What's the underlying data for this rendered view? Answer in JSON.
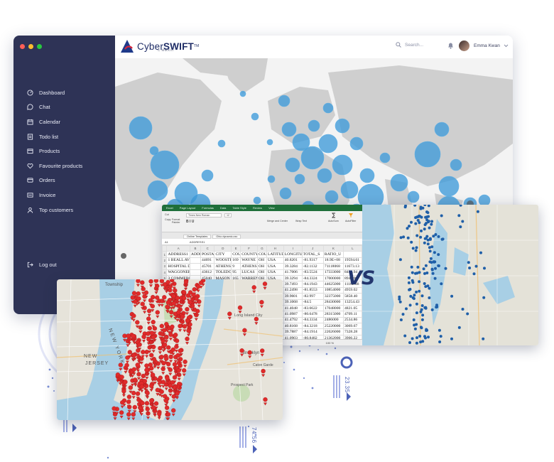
{
  "window": {
    "traffic_colors": [
      "#ff5f57",
      "#febc2e",
      "#28c840"
    ]
  },
  "brand": {
    "name_light": "Cyber",
    "name_bold": "SWIFT",
    "trademark": "TM",
    "sub": "C MMXIII",
    "logo_colors": [
      "#1f3a8a",
      "#d7263d"
    ]
  },
  "header": {
    "search_placeholder": "Search...",
    "user_name": "Emma Kwan"
  },
  "sidebar": {
    "items": [
      {
        "label": "Dashboard",
        "icon": "dashboard-icon"
      },
      {
        "label": "Chat",
        "icon": "chat-icon"
      },
      {
        "label": "Calendar",
        "icon": "calendar-icon"
      },
      {
        "label": "Todo list",
        "icon": "todo-icon"
      },
      {
        "label": "Products",
        "icon": "products-icon"
      },
      {
        "label": "Favourite products",
        "icon": "heart-icon"
      },
      {
        "label": "Orders",
        "icon": "orders-icon"
      },
      {
        "label": "Invoice",
        "icon": "invoice-icon"
      },
      {
        "label": "Top customers",
        "icon": "user-icon"
      }
    ],
    "logout": "Log out"
  },
  "excel": {
    "tabs": [
      "Excel",
      "Page Layout",
      "Formulas",
      "Data",
      "Table Style",
      "Review",
      "View"
    ],
    "font": "Times New Roman",
    "font_size": "12",
    "ribbon_labels": [
      "Cut",
      "Copy",
      "Format Painter",
      "Merge and Center",
      "Wrap Text",
      "AutoSum",
      "AutoFilter"
    ],
    "sheet_tabs": [
      "Online Templates",
      "Ohio dynamic.csv"
    ],
    "cell_ref": "A1",
    "formula": "ADDRESS1",
    "columns": [
      "A",
      "B",
      "C",
      "D",
      "E",
      "F",
      "G",
      "H",
      "I",
      "J",
      "K",
      "L"
    ],
    "rows": [
      {
        "n": "1",
        "cells": [
          "ADDRESS1",
          "ADDRESS2",
          "POSTAL",
          "CITY",
          "COUNTY",
          "COUNTY STATE",
          "COUNTRY",
          "LATITUDE",
          "LONGITUDE",
          "TOTAL_S",
          "RATIO_U"
        ]
      },
      {
        "n": "2",
        "cells": [
          "1 BEALL AVE",
          "",
          "44691",
          "WOOSTER",
          "169",
          "WAYNE",
          "OH",
          "USA",
          "40.8201",
          "-81.9317",
          "18.9E+08",
          "19594.61"
        ]
      },
      {
        "n": "3",
        "cells": [
          "HOSPITAL DR",
          "",
          "45701",
          "ATHENS",
          "9",
          "ATHENS",
          "OH",
          "USA",
          "39.3284",
          "-82.1132",
          "71118068",
          "11673.13"
        ]
      },
      {
        "n": "4",
        "cells": [
          "WAGGONER BL",
          "",
          "43612",
          "TOLEDO",
          "95",
          "LUCAS",
          "OH",
          "USA",
          "41.7006",
          "-83.5524",
          "17333000",
          "8452.94"
        ]
      },
      {
        "n": "5",
        "cells": [
          "3 COMMERCE C",
          "",
          "45040",
          "MASON",
          "165",
          "WARREN",
          "OH",
          "USA",
          "39.3294",
          "-84.3324",
          "17000000",
          "8944.99"
        ]
      },
      {
        "n": "6",
        "cells": [
          "",
          "",
          "",
          "",
          "",
          "",
          "",
          "",
          "39.7493",
          "-84.1943",
          "44625000",
          "11182.48"
        ]
      },
      {
        "n": "7",
        "cells": [
          "",
          "",
          "",
          "",
          "",
          "",
          "",
          "",
          "41.2498",
          "-81.8553",
          "10854000",
          "4959.02"
        ]
      },
      {
        "n": "8",
        "cells": [
          "",
          "",
          "",
          "",
          "",
          "",
          "",
          "",
          "39.9601",
          "-82.997",
          "32375000",
          "5858.40"
        ]
      },
      {
        "n": "9",
        "cells": [
          "",
          "",
          "",
          "",
          "",
          "",
          "",
          "",
          "39.1068",
          "-84.5",
          "28430000",
          "13254.43"
        ]
      },
      {
        "n": "10",
        "cells": [
          "",
          "",
          "",
          "",
          "",
          "",
          "",
          "",
          "41.4048",
          "-83.6622",
          "17048000",
          "4821.05"
        ]
      },
      {
        "n": "11",
        "cells": [
          "",
          "",
          "",
          "",
          "",
          "",
          "",
          "",
          "41.0987",
          "-80.6478",
          "28315000",
          "4709.11"
        ]
      },
      {
        "n": "12",
        "cells": [
          "",
          "",
          "",
          "",
          "",
          "",
          "",
          "",
          "41.4792",
          "-84.3334",
          "2486000",
          "2534.86"
        ]
      },
      {
        "n": "13",
        "cells": [
          "",
          "",
          "",
          "",
          "",
          "",
          "",
          "",
          "40.8168",
          "-84.3218",
          "25220000",
          "3069.67"
        ]
      },
      {
        "n": "14",
        "cells": [
          "",
          "",
          "",
          "",
          "",
          "",
          "",
          "",
          "39.7887",
          "-84.1914",
          "22026000",
          "7328.28"
        ]
      },
      {
        "n": "15",
        "cells": [
          "",
          "",
          "",
          "",
          "",
          "",
          "",
          "",
          "41.0903",
          "-80.8482",
          "21362000",
          "3906.22"
        ]
      },
      {
        "n": "16",
        "cells": [
          "",
          "",
          "",
          "",
          "",
          "",
          "",
          "",
          "39.7075",
          "-84.3935",
          "20250000",
          "5604.75"
        ]
      }
    ],
    "zoom": "100 %"
  },
  "vs_label": "VS",
  "nyc_labels": [
    "Township",
    "NEW YORK",
    "NEW",
    "JERSEY",
    "Long Island City",
    "Brooklyn",
    "Caton Garde",
    "Prospect Park"
  ],
  "decor_numbers": [
    "23.35",
    "74.56"
  ],
  "colors": {
    "sidebar": "#2e3356",
    "bubble": "#3d9ad9",
    "pin": "#e02a2a",
    "seattle_dot": "#1f5fa8",
    "accent": "#4d63b8"
  }
}
